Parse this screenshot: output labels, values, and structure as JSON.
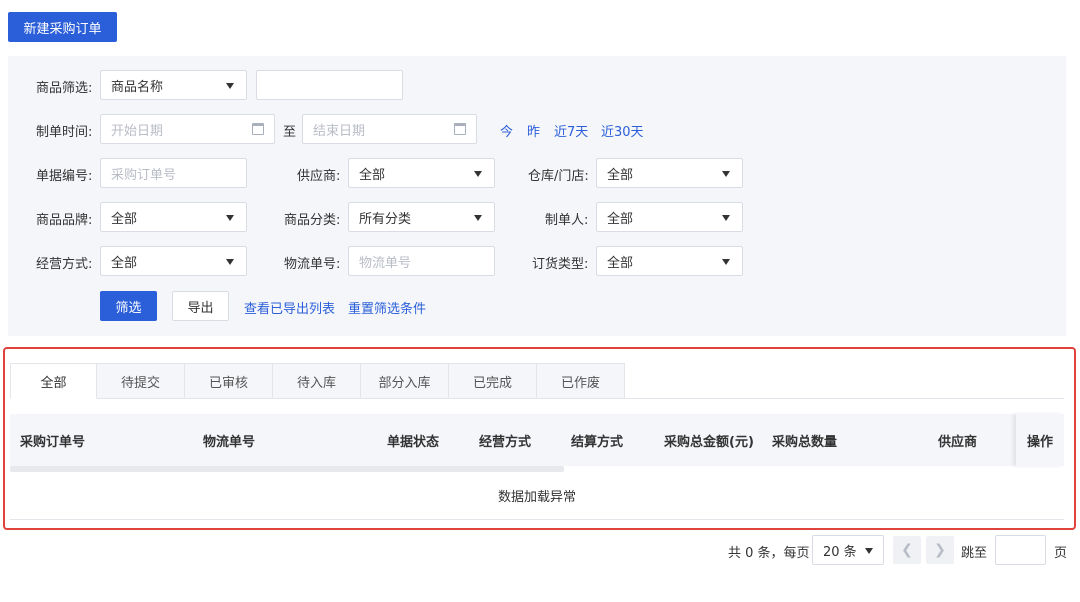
{
  "toolbar": {
    "new_order_label": "新建采购订单"
  },
  "filters": {
    "product_filter": {
      "label": "商品筛选:",
      "select_value": "商品名称",
      "input_value": ""
    },
    "created_time": {
      "label": "制单时间:",
      "start_placeholder": "开始日期",
      "to_label": "至",
      "end_placeholder": "结束日期",
      "quick": [
        "今",
        "昨",
        "近7天",
        "近30天"
      ]
    },
    "doc_number": {
      "label": "单据编号:",
      "placeholder": "采购订单号"
    },
    "supplier": {
      "label": "供应商:",
      "value": "全部"
    },
    "warehouse": {
      "label": "仓库/门店:",
      "value": "全部"
    },
    "brand": {
      "label": "商品品牌:",
      "value": "全部"
    },
    "category": {
      "label": "商品分类:",
      "value": "所有分类"
    },
    "creator": {
      "label": "制单人:",
      "value": "全部"
    },
    "business_mode": {
      "label": "经营方式:",
      "value": "全部"
    },
    "logistics_no": {
      "label": "物流单号:",
      "placeholder": "物流单号"
    },
    "order_type": {
      "label": "订货类型:",
      "value": "全部"
    },
    "actions": {
      "filter_label": "筛选",
      "export_label": "导出",
      "view_exports_label": "查看已导出列表",
      "reset_label": "重置筛选条件"
    }
  },
  "tabs": [
    "全部",
    "待提交",
    "已审核",
    "待入库",
    "部分入库",
    "已完成",
    "已作废"
  ],
  "table": {
    "columns": [
      "采购订单号",
      "物流单号",
      "单据状态",
      "经营方式",
      "结算方式",
      "采购总金额(元)",
      "采购总数量",
      "供应商",
      "操作"
    ],
    "empty_text": "数据加载异常"
  },
  "pagination": {
    "total_text": "共 0 条，每页",
    "page_size": "20 条",
    "jump_label": "跳至",
    "page_unit": "页",
    "jump_value": ""
  },
  "colors": {
    "primary": "#2b5fd9",
    "panel_bg": "#f4f6fa",
    "highlight_border": "#e0433c"
  }
}
